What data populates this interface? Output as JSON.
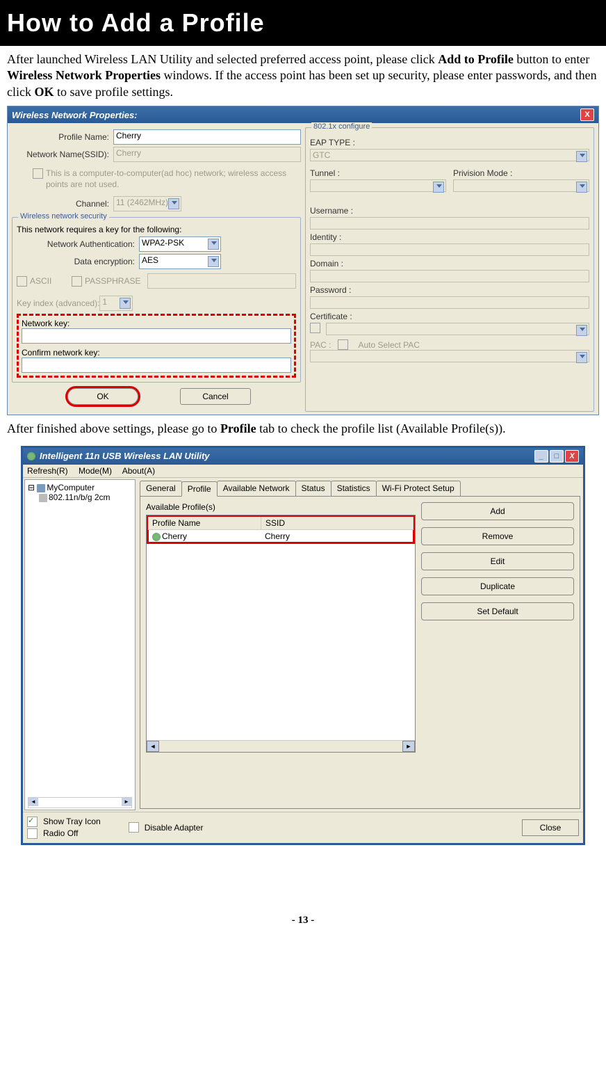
{
  "page": {
    "title": "How to Add a Profile",
    "para1_a": "After launched Wireless LAN Utility and selected preferred access point, please click ",
    "para1_b": "Add to Profile",
    "para1_c": " button to enter ",
    "para1_d": "Wireless Network Properties",
    "para1_e": " windows. If the access point has been set up security, please enter passwords, and then click ",
    "para1_f": "OK",
    "para1_g": " to save profile settings.",
    "para2_a": "After finished above settings, please go to ",
    "para2_b": "Profile",
    "para2_c": " tab to check the profile list (Available Profile(s)).",
    "number": "- 13 -"
  },
  "dlg1": {
    "title": "Wireless Network Properties:",
    "close": "X",
    "profile_name_lbl": "Profile Name:",
    "profile_name_val": "Cherry",
    "ssid_lbl": "Network Name(SSID):",
    "ssid_val": "Cherry",
    "adhoc_note": "This is a computer-to-computer(ad hoc) network; wireless access points are not used.",
    "channel_lbl": "Channel:",
    "channel_val": "11 (2462MHz)",
    "security_group": "Wireless network security",
    "security_note": "This network requires a key for the following:",
    "auth_lbl": "Network Authentication:",
    "auth_val": "WPA2-PSK",
    "enc_lbl": "Data encryption:",
    "enc_val": "AES",
    "ascii": "ASCII",
    "passphrase": "PASSPHRASE",
    "keyidx_lbl": "Key index (advanced):",
    "keyidx_val": "1",
    "netkey_lbl": "Network key:",
    "confirm_lbl": "Confirm network key:",
    "ok": "OK",
    "cancel": "Cancel",
    "r_group": "802.1x configure",
    "eap_lbl": "EAP TYPE :",
    "eap_val": "GTC",
    "tunnel_lbl": "Tunnel :",
    "priv_lbl": "Privision Mode :",
    "user_lbl": "Username :",
    "ident_lbl": "Identity :",
    "domain_lbl": "Domain :",
    "pass_lbl": "Password :",
    "cert_lbl": "Certificate :",
    "pac_lbl": "PAC :",
    "pac_cb": "Auto Select PAC"
  },
  "dlg2": {
    "title": "Intelligent 11n USB Wireless LAN Utility",
    "menu": {
      "refresh": "Refresh(R)",
      "mode": "Mode(M)",
      "about": "About(A)"
    },
    "tree": {
      "root": "MyComputer",
      "child": "802.11n/b/g 2cm"
    },
    "tabs": {
      "general": "General",
      "profile": "Profile",
      "avail": "Available Network",
      "status": "Status",
      "stats": "Statistics",
      "wps": "Wi-Fi Protect Setup"
    },
    "plist_lbl": "Available Profile(s)",
    "hdr": {
      "name": "Profile Name",
      "ssid": "SSID"
    },
    "row": {
      "name": "Cherry",
      "ssid": "Cherry"
    },
    "btns": {
      "add": "Add",
      "remove": "Remove",
      "edit": "Edit",
      "dup": "Duplicate",
      "setdef": "Set Default"
    },
    "bottom": {
      "tray": "Show Tray Icon",
      "radio": "Radio Off",
      "disable": "Disable Adapter",
      "close": "Close"
    }
  }
}
